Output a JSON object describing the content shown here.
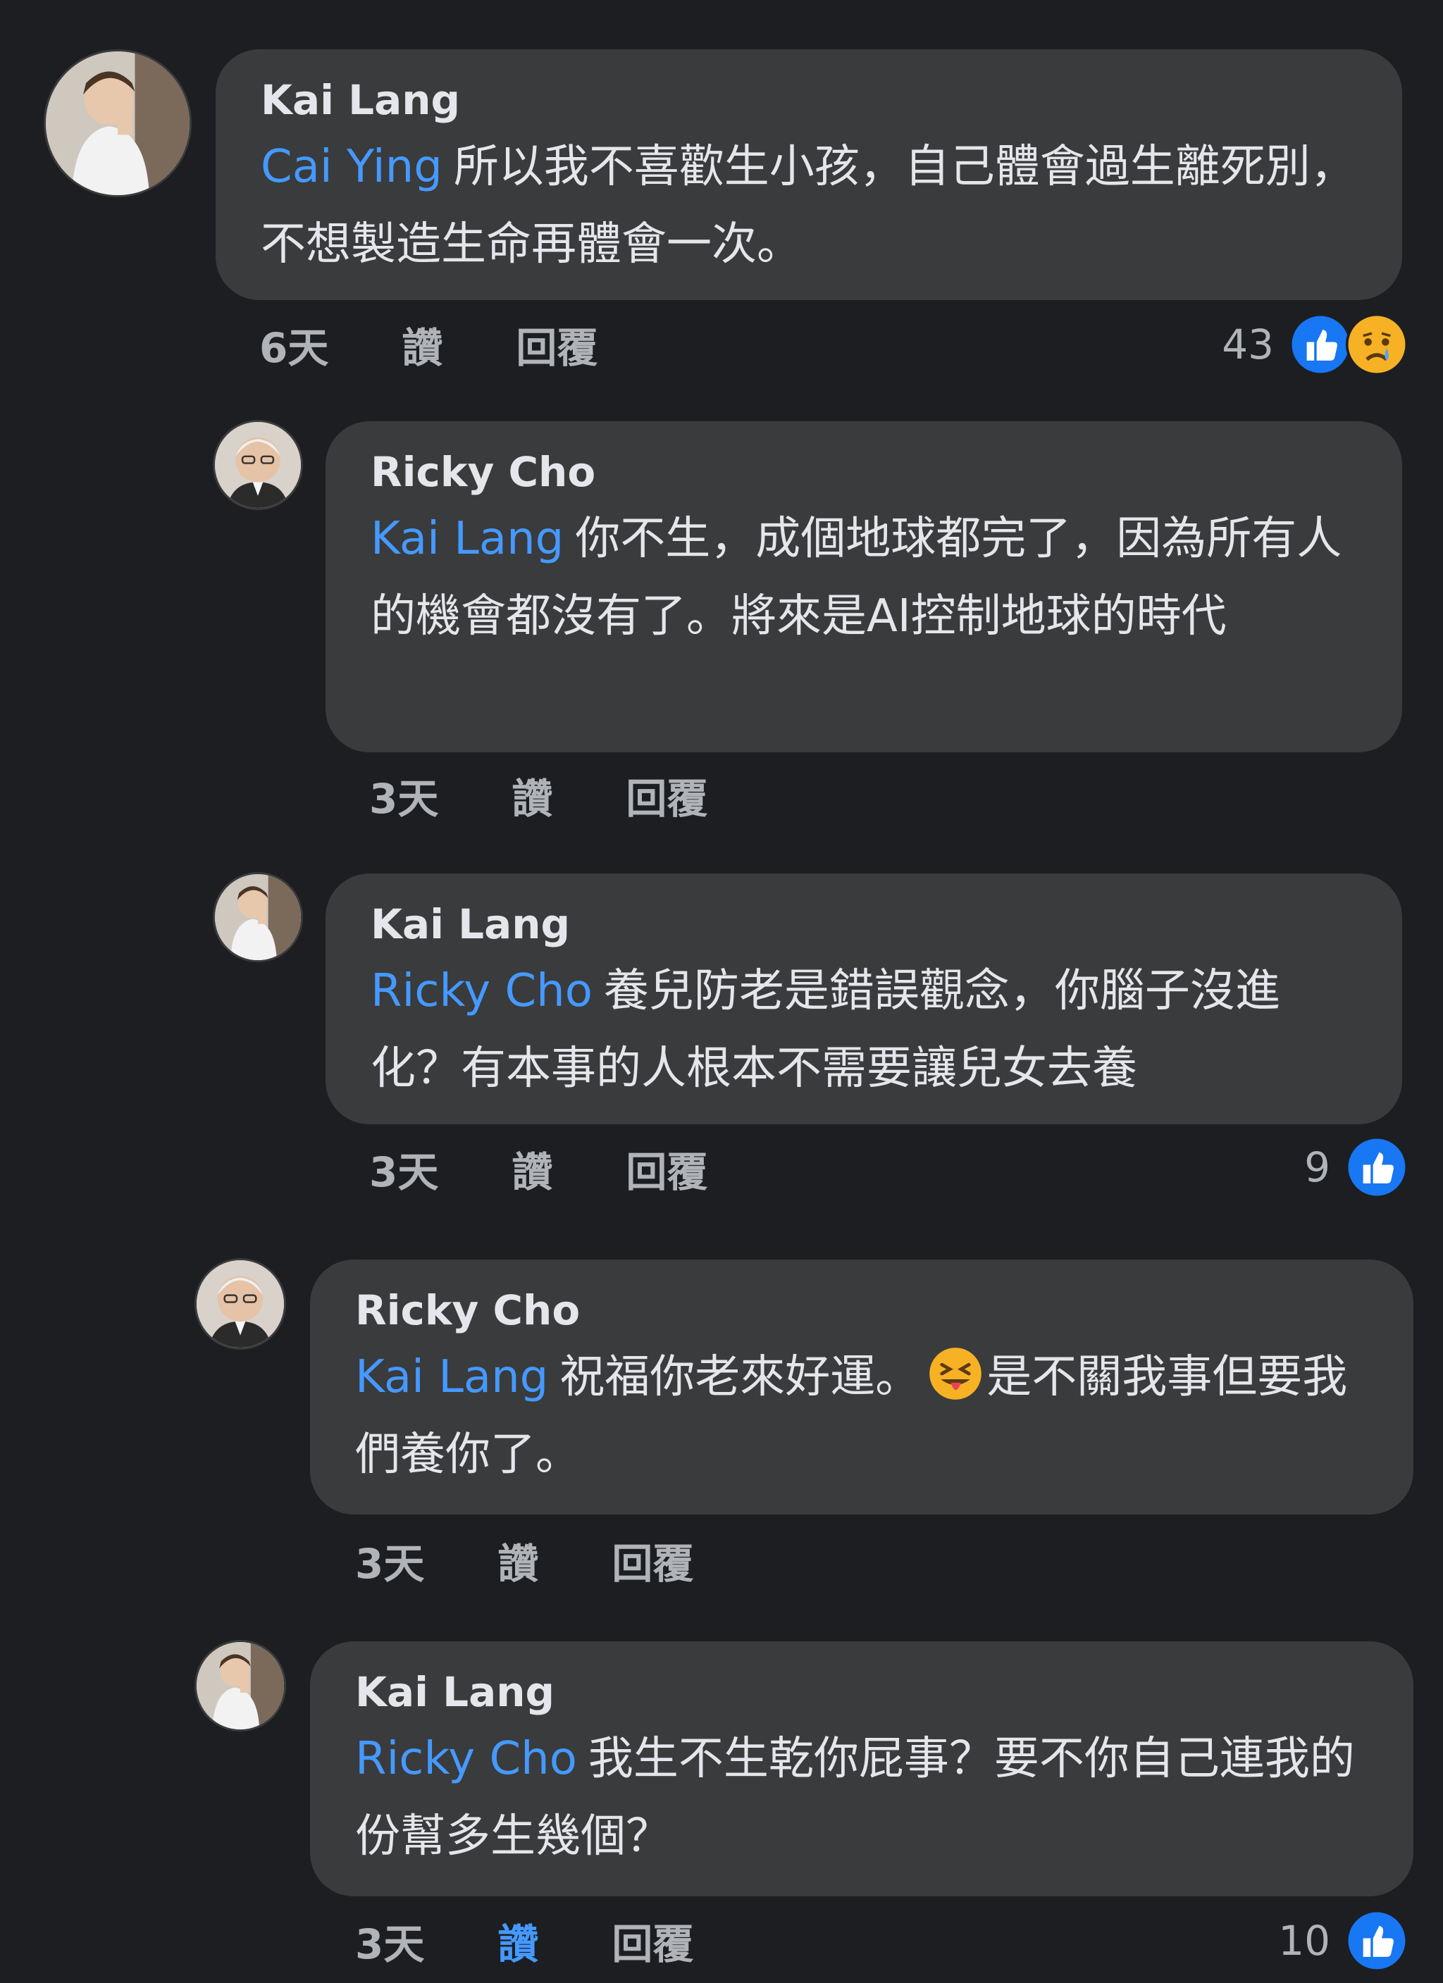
{
  "comments": [
    {
      "author": "Kai Lang",
      "mention": "Cai Ying",
      "text": "所以我不喜歡生小孩，自己體會過生離死別，不想製造生命再體會一次。",
      "time": "6天",
      "like": "讚",
      "reply": "回覆",
      "reaction_count": "43",
      "reactions": [
        "like-icon",
        "sad-icon"
      ],
      "avatar": "young-man-avatar"
    },
    {
      "author": "Ricky Cho",
      "mention": "Kai Lang",
      "text": "你不生，成個地球都完了，因為所有人的機會都沒有了。將來是AI控制地球的時代",
      "time": "3天",
      "like": "讚",
      "reply": "回覆",
      "avatar": "older-man-avatar"
    },
    {
      "author": "Kai Lang",
      "mention": "Ricky Cho",
      "text": "養兒防老是錯誤觀念，你腦子沒進化？有本事的人根本不需要讓兒女去養",
      "time": "3天",
      "like": "讚",
      "reply": "回覆",
      "reaction_count": "9",
      "reactions": [
        "like-icon"
      ],
      "avatar": "young-man-avatar"
    },
    {
      "author": "Ricky Cho",
      "mention": "Kai Lang",
      "text_before": "祝福你老來好運。",
      "emoji": "squinting-tongue-emoji",
      "text_after": "是不關我事但要我們養你了。",
      "time": "3天",
      "like": "讚",
      "reply": "回覆",
      "avatar": "older-man-avatar"
    },
    {
      "author": "Kai Lang",
      "mention": "Ricky Cho",
      "text": "我生不生乾你屁事？要不你自己連我的份幫多生幾個？",
      "time": "3天",
      "like": "讚",
      "like_active": true,
      "reply": "回覆",
      "reaction_count": "10",
      "reactions": [
        "like-icon"
      ],
      "avatar": "young-man-avatar"
    }
  ],
  "colors": {
    "background": "#1c1e21",
    "bubble": "#3a3b3c",
    "mention": "#4599ff",
    "meta": "#b0b3b8",
    "like_active": "#4599ff",
    "like_icon": "#1877f2",
    "sad_icon": "#f7b125"
  }
}
